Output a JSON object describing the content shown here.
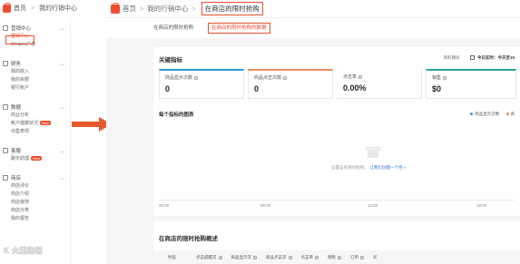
{
  "left_panel": {
    "breadcrumb": {
      "home": "首页",
      "current": "我的行销中心"
    },
    "groups": [
      {
        "title": "营销中心",
        "items": [
          "营销中心",
          "Shopee广告"
        ]
      },
      {
        "title": "财务",
        "items": [
          "我的收入",
          "我的余额",
          "银行账户"
        ]
      },
      {
        "title": "数据",
        "items": [
          "商业分析",
          "帐户健康状况",
          "出售表现"
        ],
        "badge": "New"
      },
      {
        "title": "客服",
        "items": [
          "聊天助理"
        ],
        "badge": "New"
      },
      {
        "title": "商店",
        "items": [
          "商店评价",
          "商店介绍",
          "商店装饰",
          "商店分类",
          "我的报告"
        ]
      }
    ]
  },
  "main_panel": {
    "breadcrumb": {
      "home": "首页",
      "mid": "我的行销中心",
      "current": "在商店的限时抢购"
    },
    "tabs": [
      "在商店的限时抢购",
      "在商店的限时抢购的数据"
    ],
    "card": {
      "title": "关键指标",
      "meta_label": "资料期间",
      "meta_value": "今日实时：今天至15",
      "metrics": [
        {
          "label": "商品显示次数",
          "value": "0",
          "color": "#2b9bd8"
        },
        {
          "label": "商品点击次数",
          "value": "0",
          "color": "#f28a64"
        },
        {
          "label": "点击率",
          "value": "0.00%",
          "color": "#ffffff"
        },
        {
          "label": "销售",
          "value": "$0",
          "color": "#26a9a0"
        }
      ],
      "chart_title": "每个指标的图表",
      "legend": [
        {
          "name": "商品显示次数",
          "color": "#2b9bd8"
        },
        {
          "name": "商",
          "color": "#f28a64"
        }
      ],
      "empty_text": "设置设有限时抢购，",
      "empty_link": "让我们创建一个吧 »",
      "x_ticks": [
        "00:00",
        "06:00",
        "12:00",
        "18:00"
      ]
    },
    "card2": {
      "title": "在商店的限时抢购概述",
      "columns": [
        "时段",
        "点击提醒次",
        "商品显示次",
        "商品点击次",
        "点击率",
        "销售",
        "订单",
        "买"
      ]
    }
  },
  "watermark": "K 大鹏跨境"
}
